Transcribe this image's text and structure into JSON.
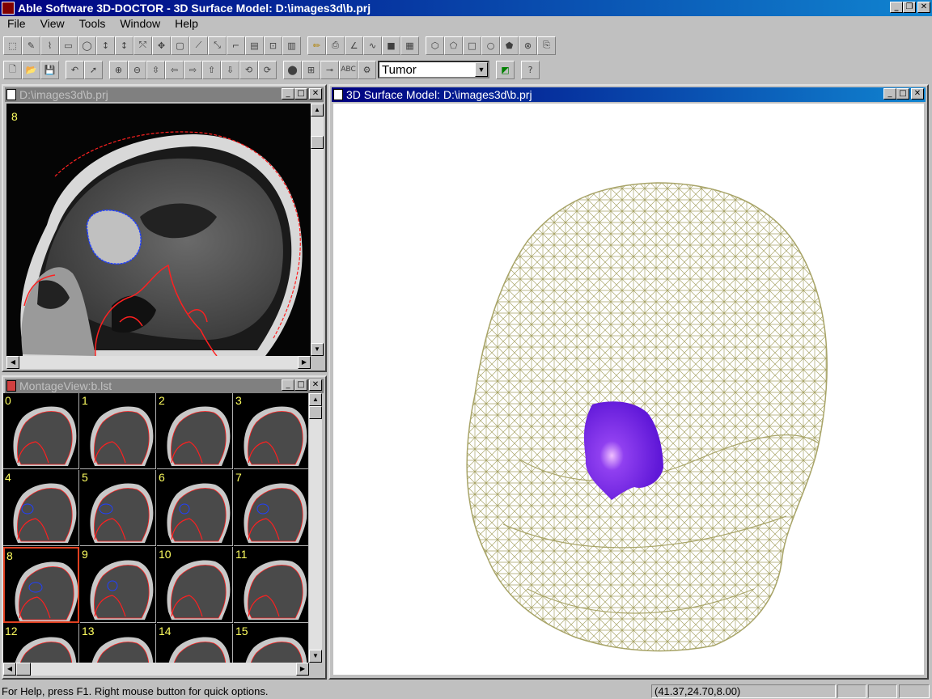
{
  "app": {
    "title": "Able Software 3D-DOCTOR - 3D Surface Model: D:\\images3d\\b.prj"
  },
  "menu": [
    "File",
    "View",
    "Tools",
    "Window",
    "Help"
  ],
  "toolbar": {
    "object_combo_value": "Tumor"
  },
  "windows": {
    "slice": {
      "title": "D:\\images3d\\b.prj",
      "slice_number": "8"
    },
    "montage": {
      "title": "MontageView:b.lst",
      "cells": [
        "0",
        "1",
        "2",
        "3",
        "4",
        "5",
        "6",
        "7",
        "8",
        "9",
        "10",
        "11",
        "12",
        "13",
        "14",
        "15"
      ],
      "selected": "8"
    },
    "surface": {
      "title": "3D Surface Model: D:\\images3d\\b.prj"
    }
  },
  "status": {
    "help_text": "For Help, press F1. Right mouse button for quick options.",
    "coords": "(41.37,24.70,8.00)"
  },
  "colors": {
    "mesh": "#a8a468",
    "tumor": "#7020e0",
    "tumor_contour": "#2040ff",
    "skin_contour": "#ff2020"
  }
}
